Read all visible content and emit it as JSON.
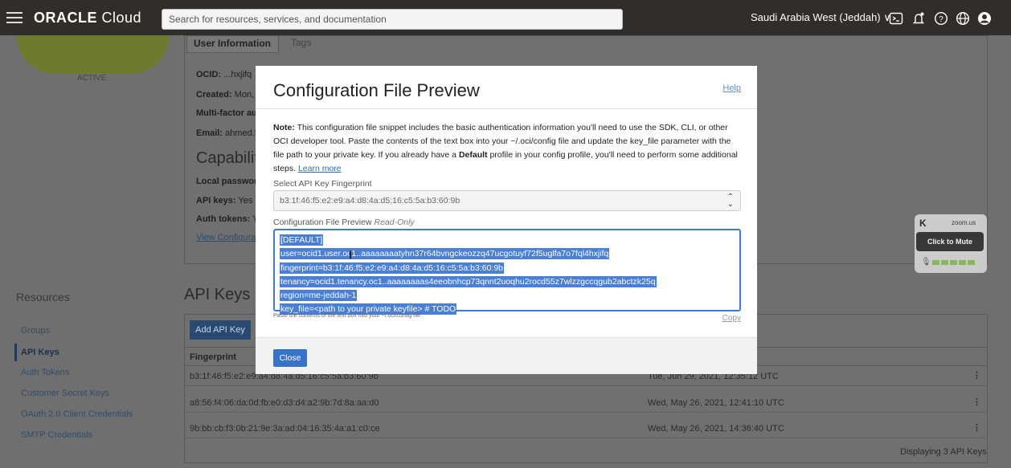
{
  "topbar": {
    "logo_bold": "ORACLE",
    "logo_rest": " Cloud",
    "search_placeholder": "Search for resources, services, and documentation",
    "region": "Saudi Arabia West (Jeddah) ∨"
  },
  "profile": {
    "status": "ACTIVE",
    "tabs": [
      "User Information",
      "Tags"
    ],
    "fields": [
      {
        "label": "OCID:",
        "value": " ...hxjifq"
      },
      {
        "label": "Created:",
        "value": " Mon,"
      },
      {
        "label": "Multi-factor au",
        "value": ""
      },
      {
        "label": "Email:",
        "value": " ahmed.f"
      }
    ],
    "capabilities_title": "Capabiliti",
    "capabilities": [
      {
        "label": "Local passwor",
        "value": ""
      },
      {
        "label": "API keys:",
        "value": " Yes"
      },
      {
        "label": "Auth tokens:",
        "value": " Y"
      }
    ],
    "view_config_link": "View Configurat"
  },
  "resources": {
    "title": "Resources",
    "items": [
      "Groups",
      "API Keys",
      "Auth Tokens",
      "Customer Secret Keys",
      "OAuth 2.0 Client Credentials",
      "SMTP Credentials"
    ],
    "active_index": 1
  },
  "api_keys": {
    "title": "API Keys",
    "add_button": "Add API Key",
    "column_fingerprint": "Fingerprint",
    "rows": [
      {
        "fingerprint": "b3:1f:46:f5:e2:e9:a4:d8:4a:d5:16:c5:5a:b3:60:9b",
        "date": "Tue, Jun 29, 2021, 12:35:12 UTC"
      },
      {
        "fingerprint": "a8:56:f4:06:da:0d:fb:e0:d3:d4:a2:9b:7d:8a:aa:d0",
        "date": "Wed, May 26, 2021, 12:41:10 UTC"
      },
      {
        "fingerprint": "9b:bb:cb:f3:0b:21:9e:3a:ad:04:16:35:4a:a1:c0:ce",
        "date": "Wed, May 26, 2021, 14:36:40 UTC"
      }
    ],
    "displaying": "Displaying 3 API Keys"
  },
  "zoom_widget": {
    "brand": "zoom.us",
    "mute_label": "Click to Mute"
  },
  "modal": {
    "title": "Configuration File Preview",
    "help": "Help",
    "note_bold": "Note:",
    "note_text_1": " This configuration file snippet includes the basic authentication information you'll need to use the SDK, CLI, or other OCI developer tool. Paste the contents of the text box into your ~/.oci/config file and update the key_file parameter with the file path to your private key. If you already have a ",
    "note_default": "Default",
    "note_text_2": " profile in your config profile, you'll need to perform some additional steps. ",
    "learn_more": "Learn more",
    "select_label": "Select API Key Fingerprint",
    "select_value": "b3:1f:46:f5:e2:e9:a4:d8:4a:d5:16:c5:5a:b3:60:9b",
    "preview_label": "Configuration File Preview",
    "preview_readonly": "Read-Only",
    "config_lines": [
      "[DEFAULT]",
      "user=ocid1.user.oc1..aaaaaaaatyhn37r64bvngckeozzq47ucgotuyf72f5uglfa7o7fql4hxjifq",
      "fingerprint=b3:1f:46:f5:e2:e9:a4:d8:4a:d5:16:c5:5a:b3:60:9b",
      "tenancy=ocid1.tenancy.oc1..aaaaaaaas4eeobnhcp73qnnt2uoqhu2rocd55z7wlzzgccqgub2abctzk25q",
      "region=me-jeddah-1",
      "key_file=<path to your private keyfile> # TODO"
    ],
    "hint": "Paste the contents of the text box into your ~/.oci/config file.",
    "copy": "Copy",
    "close": "Close"
  }
}
